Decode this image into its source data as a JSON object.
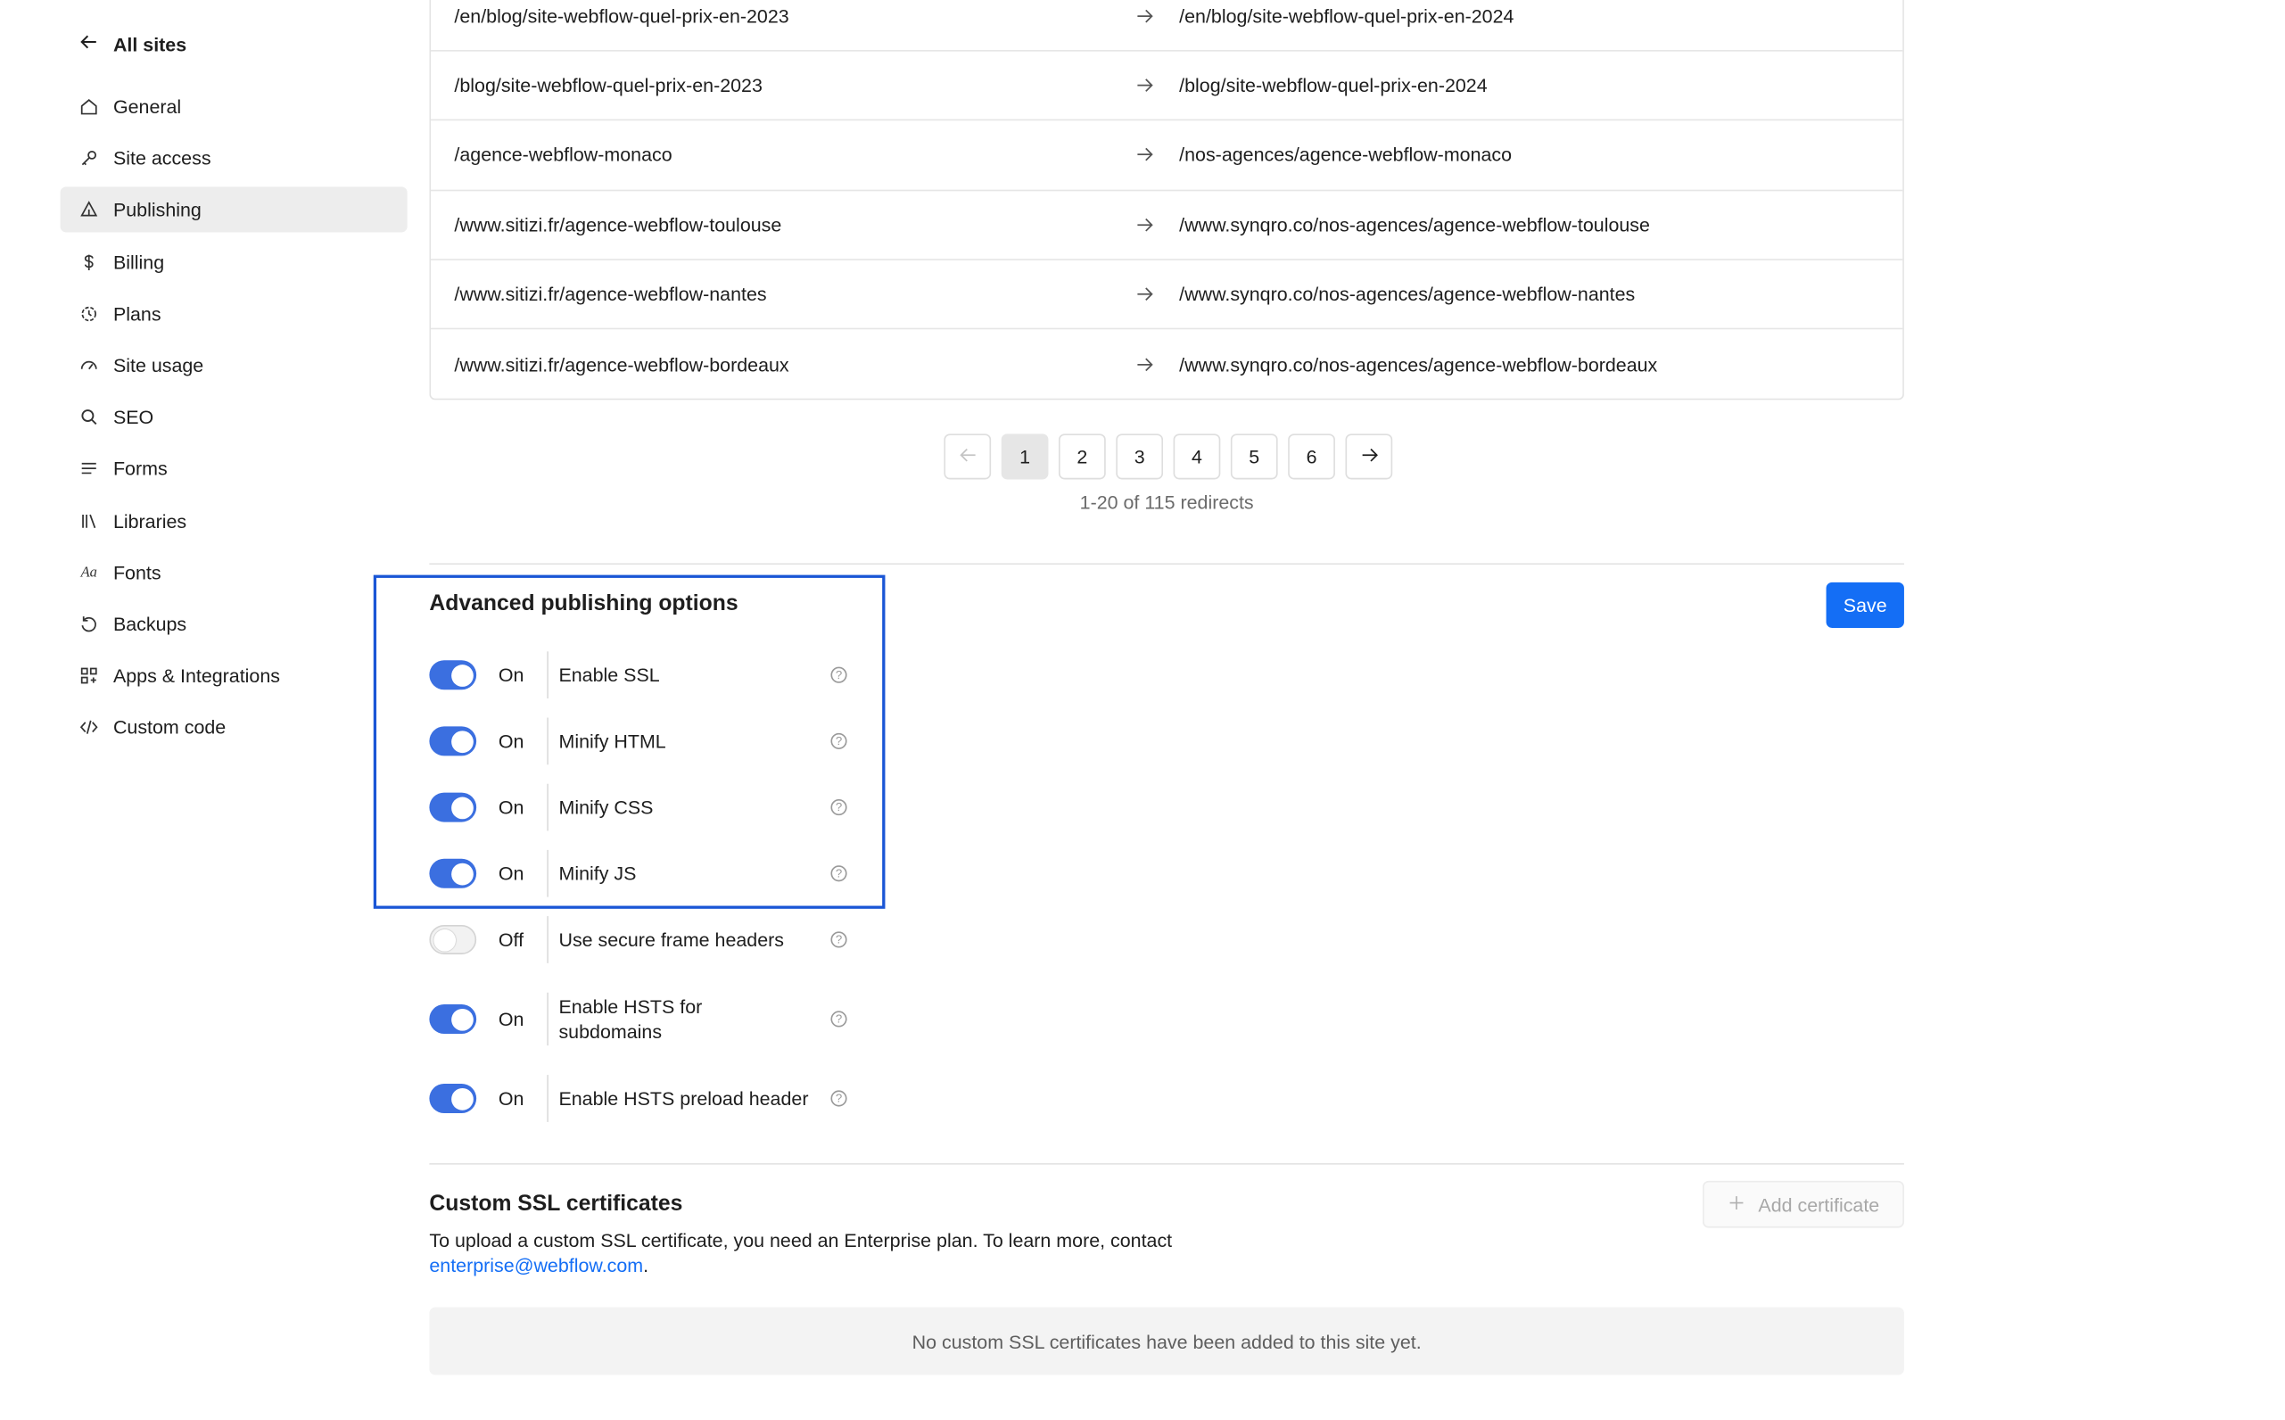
{
  "sidebar": {
    "back_label": "All sites",
    "items": [
      {
        "label": "General",
        "icon": "home-icon"
      },
      {
        "label": "Site access",
        "icon": "key-icon"
      },
      {
        "label": "Publishing",
        "icon": "publish-icon",
        "active": true
      },
      {
        "label": "Billing",
        "icon": "dollar-icon"
      },
      {
        "label": "Plans",
        "icon": "plans-icon"
      },
      {
        "label": "Site usage",
        "icon": "gauge-icon"
      },
      {
        "label": "SEO",
        "icon": "search-icon"
      },
      {
        "label": "Forms",
        "icon": "lines-icon"
      },
      {
        "label": "Libraries",
        "icon": "libraries-icon"
      },
      {
        "label": "Fonts",
        "icon": "fonts-icon"
      },
      {
        "label": "Backups",
        "icon": "restore-icon"
      },
      {
        "label": "Apps & Integrations",
        "icon": "apps-icon"
      },
      {
        "label": "Custom code",
        "icon": "code-icon"
      }
    ]
  },
  "redirects": {
    "rows": [
      {
        "from": "/en/blog/site-webflow-quel-prix-en-2023",
        "to": "/en/blog/site-webflow-quel-prix-en-2024"
      },
      {
        "from": "/blog/site-webflow-quel-prix-en-2023",
        "to": "/blog/site-webflow-quel-prix-en-2024"
      },
      {
        "from": "/agence-webflow-monaco",
        "to": "/nos-agences/agence-webflow-monaco"
      },
      {
        "from": "/www.sitizi.fr/agence-webflow-toulouse",
        "to": "/www.synqro.co/nos-agences/agence-webflow-toulouse"
      },
      {
        "from": "/www.sitizi.fr/agence-webflow-nantes",
        "to": "/www.synqro.co/nos-agences/agence-webflow-nantes"
      },
      {
        "from": "/www.sitizi.fr/agence-webflow-bordeaux",
        "to": "/www.synqro.co/nos-agences/agence-webflow-bordeaux"
      }
    ],
    "pagination": {
      "pages": [
        "1",
        "2",
        "3",
        "4",
        "5",
        "6"
      ],
      "current": "1",
      "summary": "1-20 of 115 redirects"
    }
  },
  "advanced": {
    "title": "Advanced publishing options",
    "save_label": "Save",
    "options": [
      {
        "state": "On",
        "label": "Enable SSL",
        "enabled": true
      },
      {
        "state": "On",
        "label": "Minify HTML",
        "enabled": true
      },
      {
        "state": "On",
        "label": "Minify CSS",
        "enabled": true
      },
      {
        "state": "On",
        "label": "Minify JS",
        "enabled": true
      },
      {
        "state": "Off",
        "label": "Use secure frame headers",
        "enabled": false
      },
      {
        "state": "On",
        "label": "Enable HSTS for subdomains",
        "enabled": true
      },
      {
        "state": "On",
        "label": "Enable HSTS preload header",
        "enabled": true
      }
    ],
    "help_glyph": "?"
  },
  "ssl": {
    "title": "Custom SSL certificates",
    "description": "To upload a custom SSL certificate, you need an Enterprise plan. To learn more, contact",
    "email": "enterprise@webflow.com",
    "period": ".",
    "add_label": "Add certificate",
    "empty_message": "No custom SSL certificates have been added to this site yet."
  },
  "colors": {
    "accent": "#146ef5",
    "toggle_on": "#3b6fe0",
    "highlight_box": "#1a56d6"
  }
}
